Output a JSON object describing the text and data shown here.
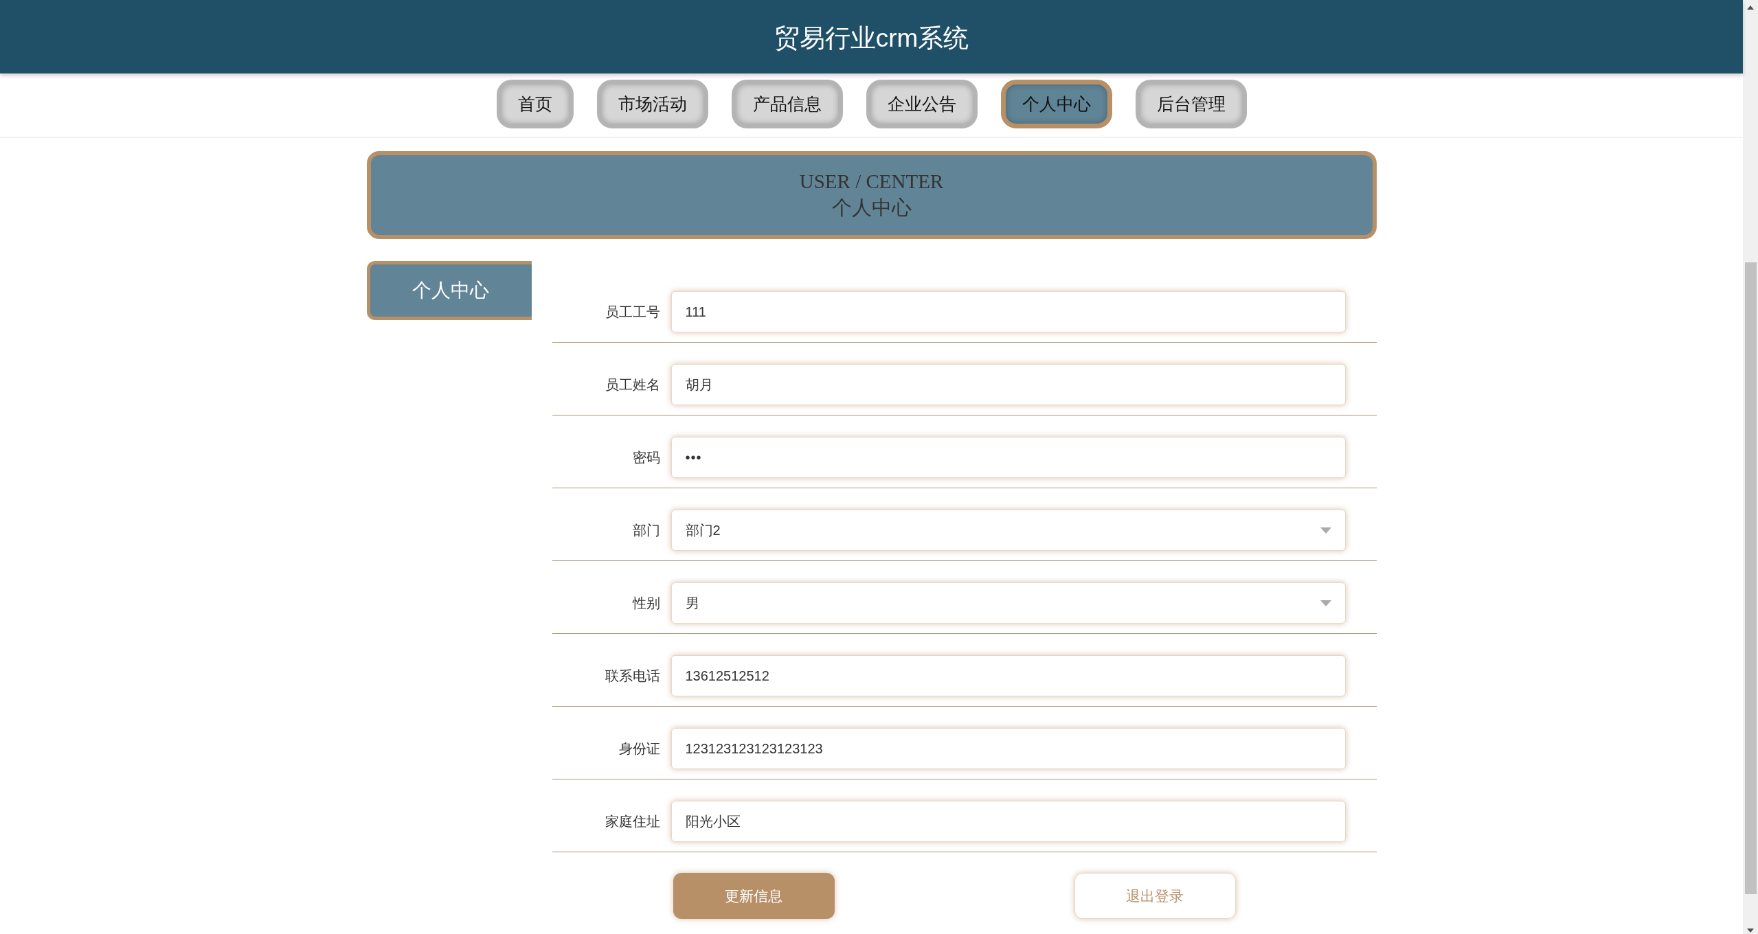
{
  "header": {
    "title": "贸易行业crm系统"
  },
  "nav": [
    {
      "label": "首页",
      "selected": false
    },
    {
      "label": "市场活动",
      "selected": false
    },
    {
      "label": "产品信息",
      "selected": false
    },
    {
      "label": "企业公告",
      "selected": false
    },
    {
      "label": "个人中心",
      "selected": true
    },
    {
      "label": "后台管理",
      "selected": false
    }
  ],
  "banner": {
    "title_en": "USER / CENTER",
    "title_zh": "个人中心"
  },
  "sidebar": {
    "items": [
      {
        "label": "个人中心",
        "selected": true
      }
    ]
  },
  "form": {
    "fields": [
      {
        "label": "员工工号",
        "kind": "text",
        "value": "111"
      },
      {
        "label": "员工姓名",
        "kind": "text",
        "value": "胡月"
      },
      {
        "label": "密码",
        "kind": "password",
        "value": "•••"
      },
      {
        "label": "部门",
        "kind": "select",
        "value": "部门2"
      },
      {
        "label": "性别",
        "kind": "select",
        "value": "男"
      },
      {
        "label": "联系电话",
        "kind": "text",
        "value": "13612512512"
      },
      {
        "label": "身份证",
        "kind": "text",
        "value": "123123123123123123"
      },
      {
        "label": "家庭住址",
        "kind": "text",
        "value": "阳光小区"
      }
    ],
    "buttons": [
      {
        "label": "更新信息",
        "kind": "primary"
      },
      {
        "label": "退出登录",
        "kind": "secondary"
      }
    ]
  }
}
